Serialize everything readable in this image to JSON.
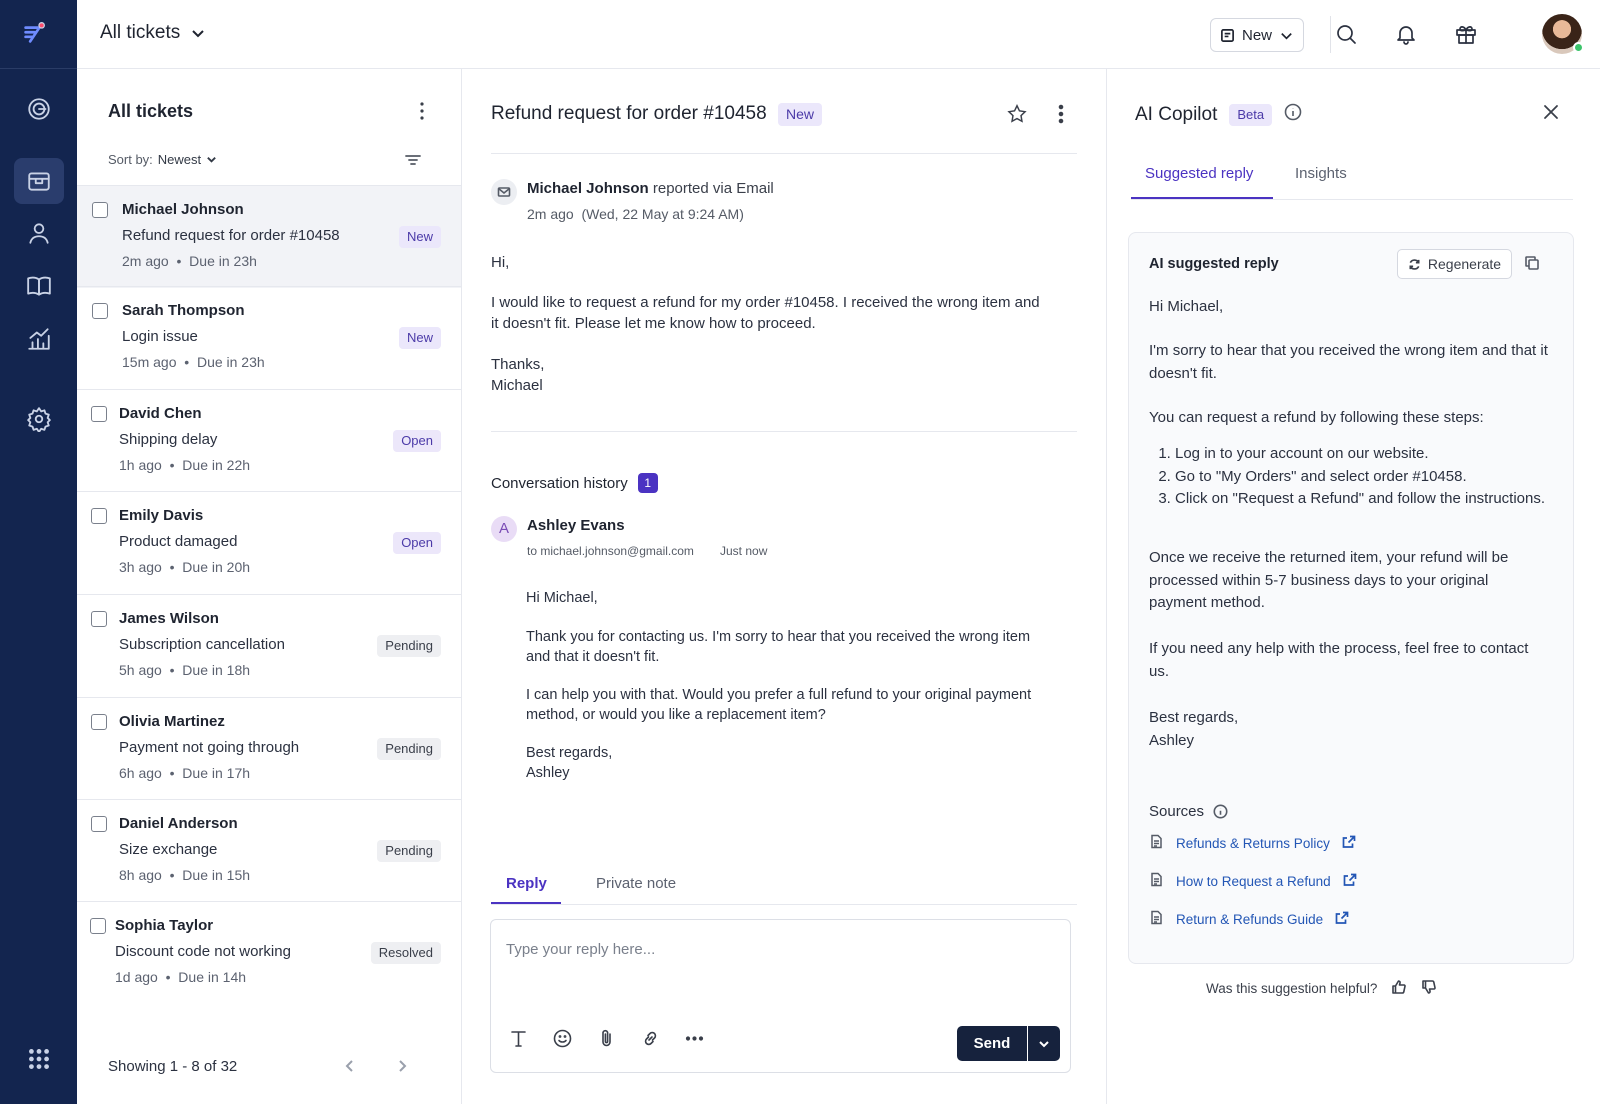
{
  "topbar": {
    "view_title": "All tickets",
    "new_button_label": "New"
  },
  "ticket_list": {
    "title": "All tickets",
    "sort_label": "Sort by:",
    "sort_value": "Newest",
    "tickets": [
      {
        "name": "Michael Johnson",
        "subject": "Refund request for order #10458",
        "age": "2m ago",
        "due": "Due in 23h",
        "status": "New"
      },
      {
        "name": "Sarah Thompson",
        "subject": "Login issue",
        "age": "15m ago",
        "due": "Due in 23h",
        "status": "New"
      },
      {
        "name": "David Chen",
        "subject": "Shipping delay",
        "age": "1h ago",
        "due": "Due in 22h",
        "status": "Open"
      },
      {
        "name": "Emily Davis",
        "subject": "Product damaged",
        "age": "3h ago",
        "due": "Due in 20h",
        "status": "Open"
      },
      {
        "name": "James Wilson",
        "subject": "Subscription cancellation",
        "age": "5h ago",
        "due": "Due in 18h",
        "status": "Pending"
      },
      {
        "name": "Olivia Martinez",
        "subject": "Payment not going through",
        "age": "6h ago",
        "due": "Due in 17h",
        "status": "Pending"
      },
      {
        "name": "Daniel Anderson",
        "subject": "Size exchange",
        "age": "8h ago",
        "due": "Due in 15h",
        "status": "Pending"
      },
      {
        "name": "Sophia Taylor",
        "subject": "Discount code not working",
        "age": "1d ago",
        "due": "Due in 14h",
        "status": "Resolved"
      }
    ],
    "pagination": "Showing 1 - 8 of 32"
  },
  "ticket": {
    "subject": "Refund request for order #10458",
    "status": "New",
    "reporter_name": "Michael Johnson",
    "reporter_suffix": "reported via Email",
    "received": "2m ago",
    "received_full": "(Wed, 22 May at 9:24 AM)",
    "body": [
      "Hi,",
      "I would like to request a refund for my order #10458. I received the wrong item and it doesn't fit. Please let me know how to proceed.",
      "Thanks,",
      "Michael"
    ],
    "conversation_label": "Conversation history",
    "conversation_count": "1",
    "reply": {
      "agent_initial": "A",
      "agent_name": "Ashley Evans",
      "to": "to  michael.johnson@gmail.com",
      "when": "Just now",
      "paragraphs": [
        "Hi Michael,",
        "Thank you for contacting us. I'm sorry to hear that you received the wrong item and that it doesn't fit.",
        "I can help you with that. Would you prefer a full refund to your original payment method, or would you like a replacement item?",
        "Best regards,",
        "Ashley"
      ]
    },
    "composer": {
      "tab_reply": "Reply",
      "tab_note": "Private note",
      "placeholder": "Type your reply here...",
      "send_label": "Send"
    }
  },
  "copilot": {
    "title": "AI Copilot",
    "badge": "Beta",
    "tab_suggested": "Suggested reply",
    "tab_insights": "Insights",
    "card_title": "AI suggested reply",
    "regenerate_label": "Regenerate",
    "greeting": "Hi Michael,",
    "p1": "I'm sorry to hear that you received the wrong item and that it doesn't fit.",
    "p2": "You can request a refund by following these steps:",
    "steps": [
      "Log in to your account on our website.",
      "Go to \"My Orders\" and select order #10458.",
      "Click on \"Request a Refund\" and follow the instructions."
    ],
    "p3": "Once we receive the returned item, your refund will be processed within 5-7 business days to your original payment method.",
    "p4": "If you need any help with the process, feel free to contact us.",
    "signoff": "Best regards,",
    "signature": "Ashley",
    "sources_label": "Sources",
    "sources": [
      "Refunds & Returns Policy",
      "How to Request a Refund",
      "Return & Refunds Guide"
    ],
    "helpful_question": "Was this suggestion helpful?"
  },
  "colors": {
    "rail_bg": "#13254f",
    "accent": "#4b33c2",
    "link": "#2356b5"
  }
}
